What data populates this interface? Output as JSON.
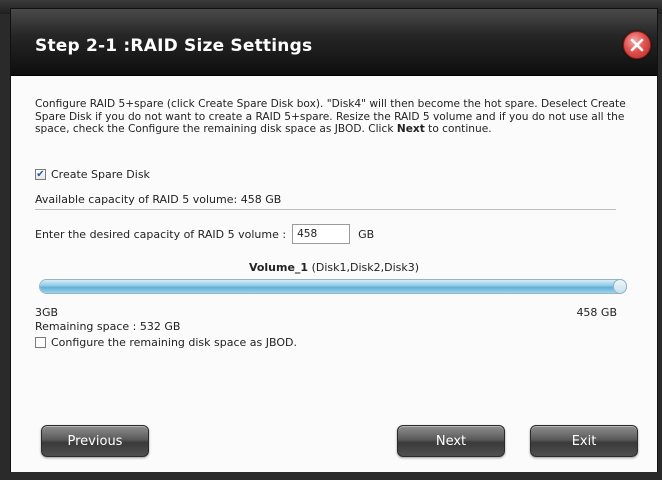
{
  "window": {
    "title": "Step 2-1 :RAID Size Settings"
  },
  "description": {
    "part1": "Configure RAID 5+spare (click Create Spare Disk box). \"Disk4\" will then become the hot spare. Deselect Create Spare Disk if you do not want to create a RAID 5+spare. Resize the RAID 5 volume and if you do not use all the space, check the Configure the remaining disk space as JBOD. Click ",
    "bold": "Next",
    "part2": " to continue."
  },
  "spare": {
    "label": "Create Spare Disk",
    "checked": true
  },
  "available": {
    "text": "Available capacity of RAID 5 volume: 458 GB"
  },
  "capacity": {
    "label": "Enter the desired capacity of RAID 5 volume :",
    "value": "458",
    "unit": "GB"
  },
  "volume": {
    "name": "Volume_1",
    "disks": " (Disk1,Disk2,Disk3)"
  },
  "slider": {
    "min_label": "3GB",
    "max_label": "458 GB",
    "fill_fraction": 1.0
  },
  "remaining": {
    "text": "Remaining space : 532 GB"
  },
  "jbod": {
    "label": "Configure the remaining disk space as JBOD.",
    "checked": false
  },
  "buttons": {
    "previous": "Previous",
    "next": "Next",
    "exit": "Exit"
  },
  "colors": {
    "close_button": "#e0524f",
    "slider_fill": "#8fcae6",
    "titlebar": "#1a1a1a"
  }
}
